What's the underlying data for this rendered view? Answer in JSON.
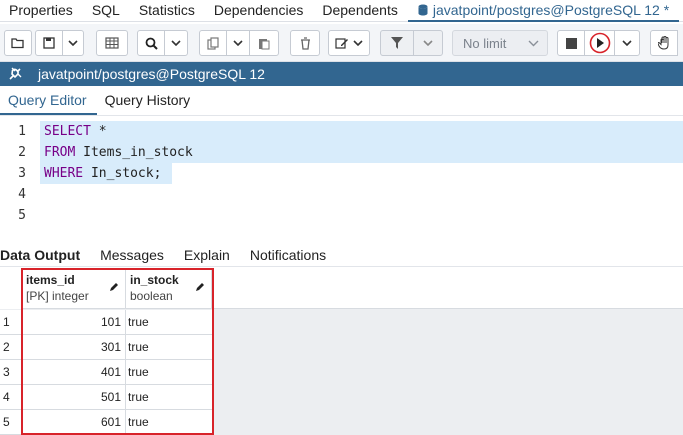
{
  "top_tabs": [
    {
      "label": "Properties"
    },
    {
      "label": "SQL"
    },
    {
      "label": "Statistics"
    },
    {
      "label": "Dependencies"
    },
    {
      "label": "Dependents"
    },
    {
      "label": "javatpoint/postgres@PostgreSQL 12 *"
    }
  ],
  "toolbar": {
    "limit_value": "No limit"
  },
  "connection": {
    "label": "javatpoint/postgres@PostgreSQL 12"
  },
  "editor_tabs": [
    {
      "label": "Query Editor"
    },
    {
      "label": "Query History"
    }
  ],
  "editor": {
    "lines": [
      {
        "num": "1",
        "kw": "SELECT",
        "rest": " *"
      },
      {
        "num": "2",
        "kw": "FROM",
        "rest": " Items_in_stock"
      },
      {
        "num": "3",
        "kw": "WHERE",
        "rest": " In_stock;"
      },
      {
        "num": "4",
        "kw": "",
        "rest": ""
      },
      {
        "num": "5",
        "kw": "",
        "rest": ""
      }
    ]
  },
  "output_tabs": [
    {
      "label": "Data Output"
    },
    {
      "label": "Messages"
    },
    {
      "label": "Explain"
    },
    {
      "label": "Notifications"
    }
  ],
  "grid": {
    "columns": [
      {
        "name": "items_id",
        "type": "[PK] integer"
      },
      {
        "name": "in_stock",
        "type": "boolean"
      }
    ],
    "rows": [
      {
        "num": "1",
        "items_id": "101",
        "in_stock": "true"
      },
      {
        "num": "2",
        "items_id": "301",
        "in_stock": "true"
      },
      {
        "num": "3",
        "items_id": "401",
        "in_stock": "true"
      },
      {
        "num": "4",
        "items_id": "501",
        "in_stock": "true"
      },
      {
        "num": "5",
        "items_id": "601",
        "in_stock": "true"
      }
    ]
  },
  "colors": {
    "accent": "#326690",
    "highlight_box": "#d8232a",
    "keyword": "#770088"
  }
}
